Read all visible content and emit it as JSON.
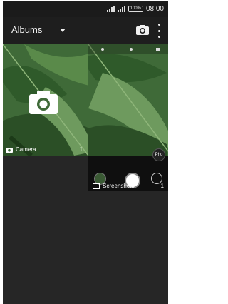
{
  "status": {
    "time": "08:00",
    "battery": "100%"
  },
  "appbar": {
    "title": "Albums"
  },
  "albums": [
    {
      "name": "Camera",
      "count": "1"
    },
    {
      "name": "Screenshots",
      "count": "1"
    }
  ],
  "preview": {
    "photo_button_label": "Pho"
  },
  "colors": {
    "background": "#262626",
    "appbar": "#1e1e1e",
    "leaf_green": "#3f6a38"
  }
}
